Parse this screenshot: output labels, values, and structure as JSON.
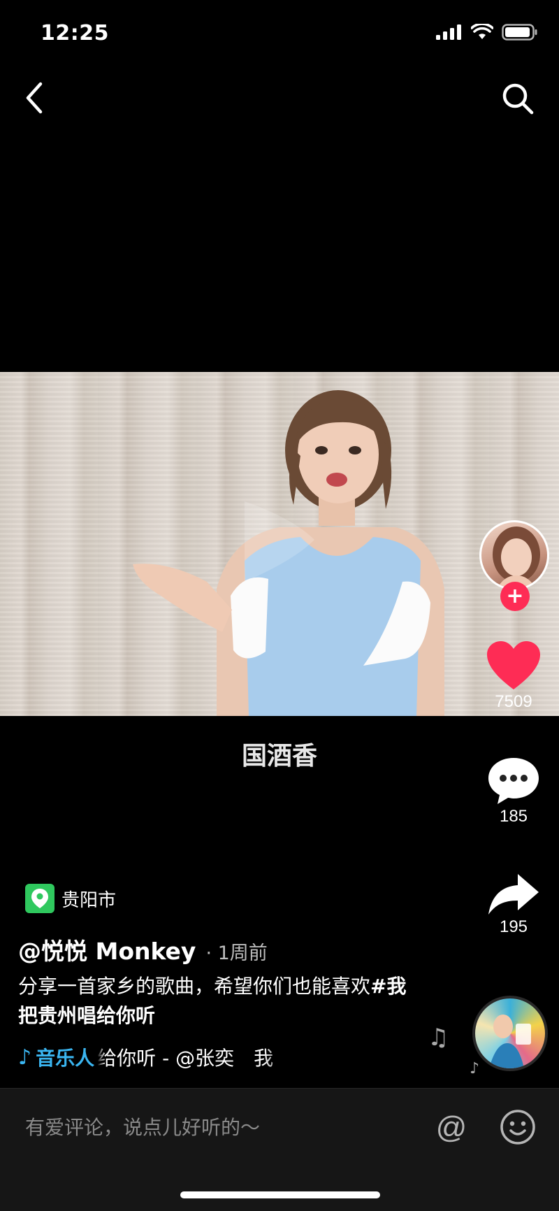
{
  "status_bar": {
    "time": "12:25",
    "icons": [
      "signal-icon",
      "wifi-icon",
      "battery-icon"
    ]
  },
  "nav": {
    "back_icon": "chevron-left-icon",
    "search_icon": "search-icon"
  },
  "video": {
    "lyric": "国酒香"
  },
  "actions": {
    "like_count": "7509",
    "comment_count": "185",
    "share_count": "195",
    "like_color": "#fe2c55",
    "follow_color": "#fe2c55"
  },
  "post": {
    "location": "贵阳市",
    "author": "@悦悦 Monkey",
    "time_ago": "· 1周前",
    "caption_text": "分享一首家乡的歌曲，希望你们也能喜欢",
    "hashtag": "#我把贵州唱给你听",
    "music_tag": "音乐人",
    "music_text": "给你听 - @张奕　我"
  },
  "comment_bar": {
    "placeholder": "有爱评论，说点儿好听的～",
    "at_label": "@"
  },
  "colors": {
    "accent_blue": "#3ab5f0",
    "location_green": "#2fc85e"
  }
}
